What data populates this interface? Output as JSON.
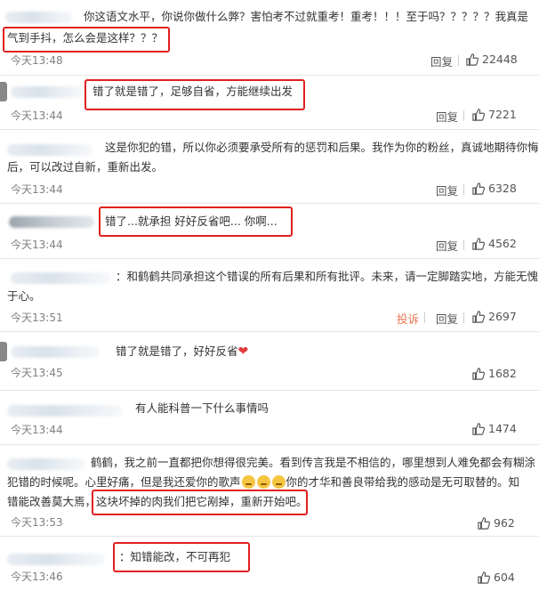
{
  "comments": [
    {
      "line1": "你这语文水平，你说你做什么弊？害怕考不过就重考！重考！！！至于吗？？？？？我真是",
      "line2": "气到手抖，怎么会是这样？？？",
      "time": "今天13:48",
      "reply": "回复",
      "likes": "22448"
    },
    {
      "line1": "错了就是错了，足够自省，方能继续出发",
      "time": "今天13:44",
      "reply": "回复",
      "likes": "7221"
    },
    {
      "line1": "这是你犯的错，所以你必须要承受所有的惩罚和后果。我作为你的粉丝，真诚地期待你悔悟",
      "line2": "后，可以改过自新，重新出发。",
      "time": "今天13:44",
      "reply": "回复",
      "likes": "6328"
    },
    {
      "line1": "错了...就承担 好好反省吧... 你啊...",
      "time": "今天13:44",
      "reply": "回复",
      "likes": "4562"
    },
    {
      "line1": "：和鹤鹤共同承担这个错误的所有后果和所有批评。未来，请一定脚踏实地，方能无愧",
      "line2": "于心。",
      "time": "今天13:51",
      "report": "投诉",
      "reply": "回复",
      "likes": "2697"
    },
    {
      "line1": "错了就是错了，好好反省",
      "time": "今天13:45",
      "likes": "1682"
    },
    {
      "line1": "有人能科普一下什么事情吗",
      "time": "今天13:44",
      "likes": "1474"
    },
    {
      "line1": "鹤鹤，我之前一直都把你想得很完美。看到传言我是不相信的，哪里想到人难免都会有糊涂",
      "line2a": "犯错的时候呢。心里好痛，但是我还爱你的歌声",
      "line2b": "你的才华和善良带给我的感动是无可取替的。知",
      "line3a": "错能改善莫大焉，",
      "line3b": "这块坏掉的肉我们把它剐掉，重新开始吧。",
      "time": "今天13:53",
      "likes": "962"
    },
    {
      "line1": "：知错能改，不可再犯",
      "time": "今天13:46",
      "likes": "604"
    }
  ]
}
